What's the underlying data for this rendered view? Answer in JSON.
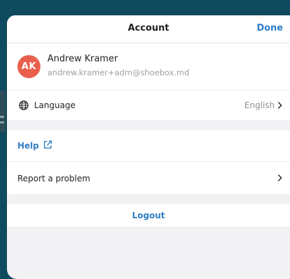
{
  "navbar": {
    "title": "Account",
    "done_label": "Done"
  },
  "profile": {
    "initials": "AK",
    "name": "Andrew Kramer",
    "email": "andrew.kramer+adm@shoebox.md",
    "avatar_color": "#e8604c"
  },
  "settings": {
    "language_label": "Language",
    "language_value": "English",
    "language_icon": "globe-icon"
  },
  "support": {
    "help_label": "Help",
    "help_icon": "external-link-icon",
    "report_label": "Report a problem"
  },
  "logout_label": "Logout",
  "colors": {
    "accent": "#2f7fc4",
    "backdrop": "#0f4a5e",
    "sheet_background": "#f2f2f4"
  }
}
